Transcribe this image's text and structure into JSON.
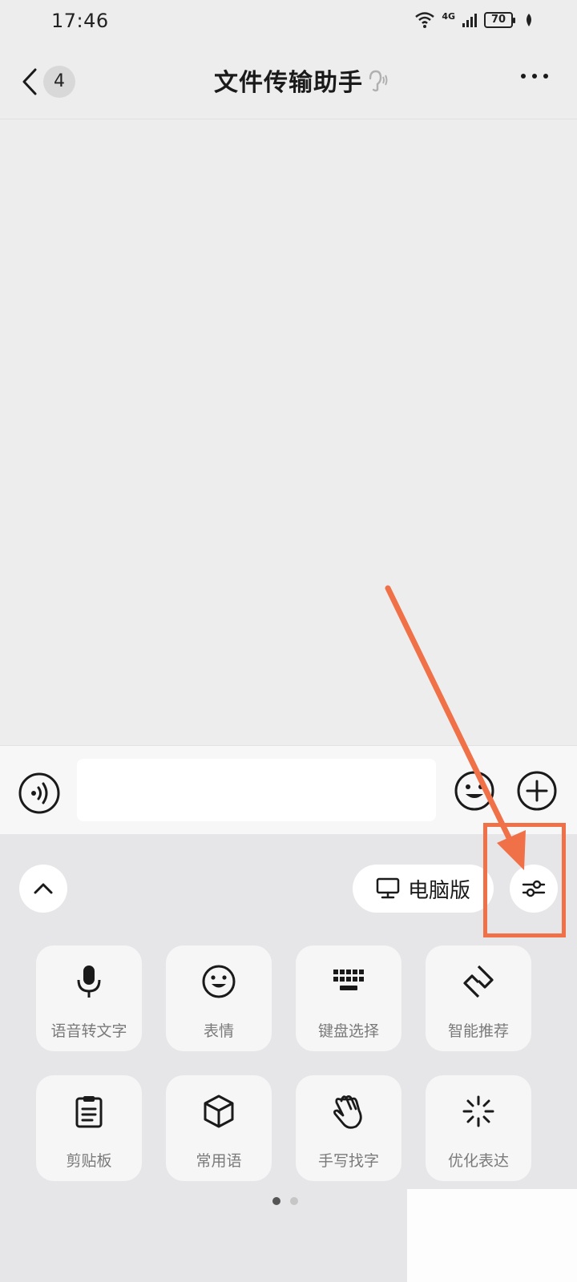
{
  "status_bar": {
    "time": "17:46",
    "network": "4G",
    "battery": "70"
  },
  "nav": {
    "unread_count": "4",
    "title": "文件传输助手"
  },
  "input": {
    "value": "",
    "placeholder": ""
  },
  "panel": {
    "pc_label": "电脑版",
    "tiles": [
      {
        "label": "语音转文字",
        "icon": "microphone-icon"
      },
      {
        "label": "表情",
        "icon": "smiley-icon"
      },
      {
        "label": "键盘选择",
        "icon": "keyboard-icon"
      },
      {
        "label": "智能推荐",
        "icon": "smart-recommend-icon"
      },
      {
        "label": "剪贴板",
        "icon": "clipboard-icon"
      },
      {
        "label": "常用语",
        "icon": "cube-icon"
      },
      {
        "label": "手写找字",
        "icon": "handwriting-icon"
      },
      {
        "label": "优化表达",
        "icon": "sparkle-icon"
      }
    ],
    "page_count": 2,
    "active_page": 1
  },
  "colors": {
    "annotation": "#f07048",
    "background": "#ededed",
    "panel": "#e6e6e8"
  }
}
